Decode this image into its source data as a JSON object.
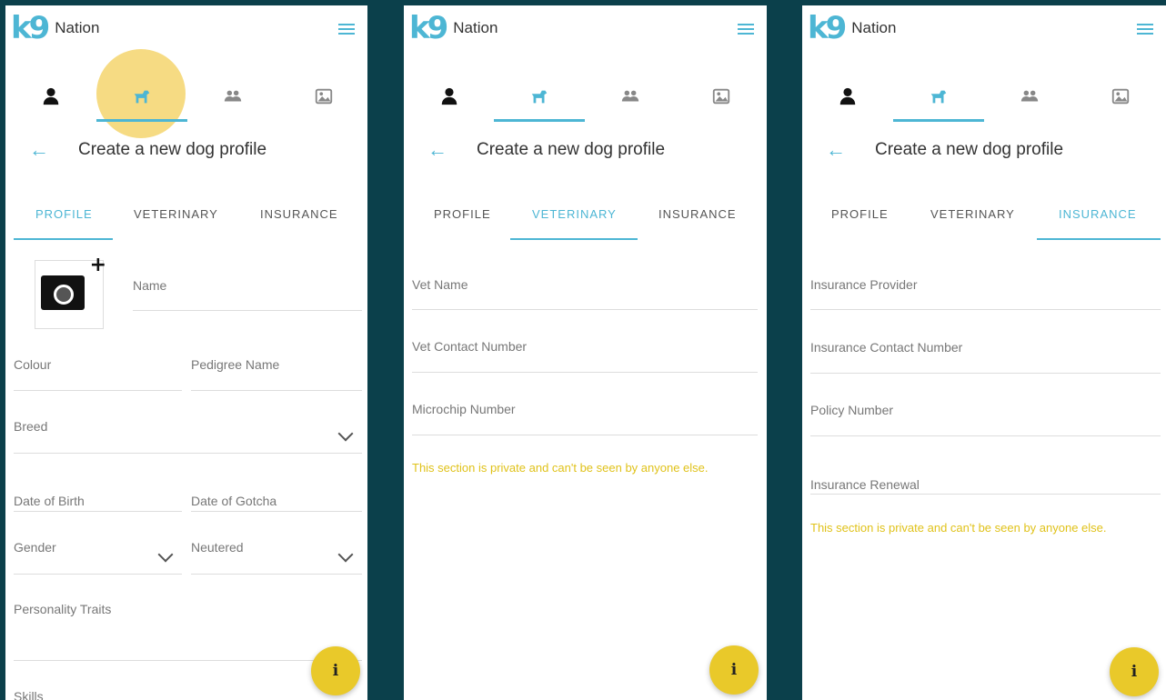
{
  "app": {
    "logo_mark": "k9",
    "name": "Nation"
  },
  "colors": {
    "accent": "#4db6d4",
    "fab": "#e9c92a",
    "note": "#e0c21a",
    "background": "#0b404b"
  },
  "page_title": "Create a new dog profile",
  "tabs": {
    "profile": "PROFILE",
    "veterinary": "VETERINARY",
    "insurance": "INSURANCE"
  },
  "fab_label": "i",
  "screen1": {
    "active_tab": "PROFILE",
    "fields": {
      "name": "Name",
      "colour": "Colour",
      "pedigree_name": "Pedigree Name",
      "breed": "Breed",
      "date_of_birth": "Date of Birth",
      "date_of_gotcha": "Date of Gotcha",
      "gender": "Gender",
      "neutered": "Neutered",
      "personality_traits": "Personality Traits",
      "skills": "Skills"
    }
  },
  "screen2": {
    "active_tab": "VETERINARY",
    "fields": {
      "vet_name": "Vet Name",
      "vet_contact_number": "Vet Contact Number",
      "microchip_number": "Microchip Number"
    },
    "note": "This section is private and can't be seen by anyone else."
  },
  "screen3": {
    "active_tab": "INSURANCE",
    "fields": {
      "insurance_provider": "Insurance Provider",
      "insurance_contact_number": "Insurance Contact Number",
      "policy_number": "Policy Number",
      "insurance_renewal": "Insurance Renewal"
    },
    "note": "This section is private and can't be seen by anyone else."
  }
}
